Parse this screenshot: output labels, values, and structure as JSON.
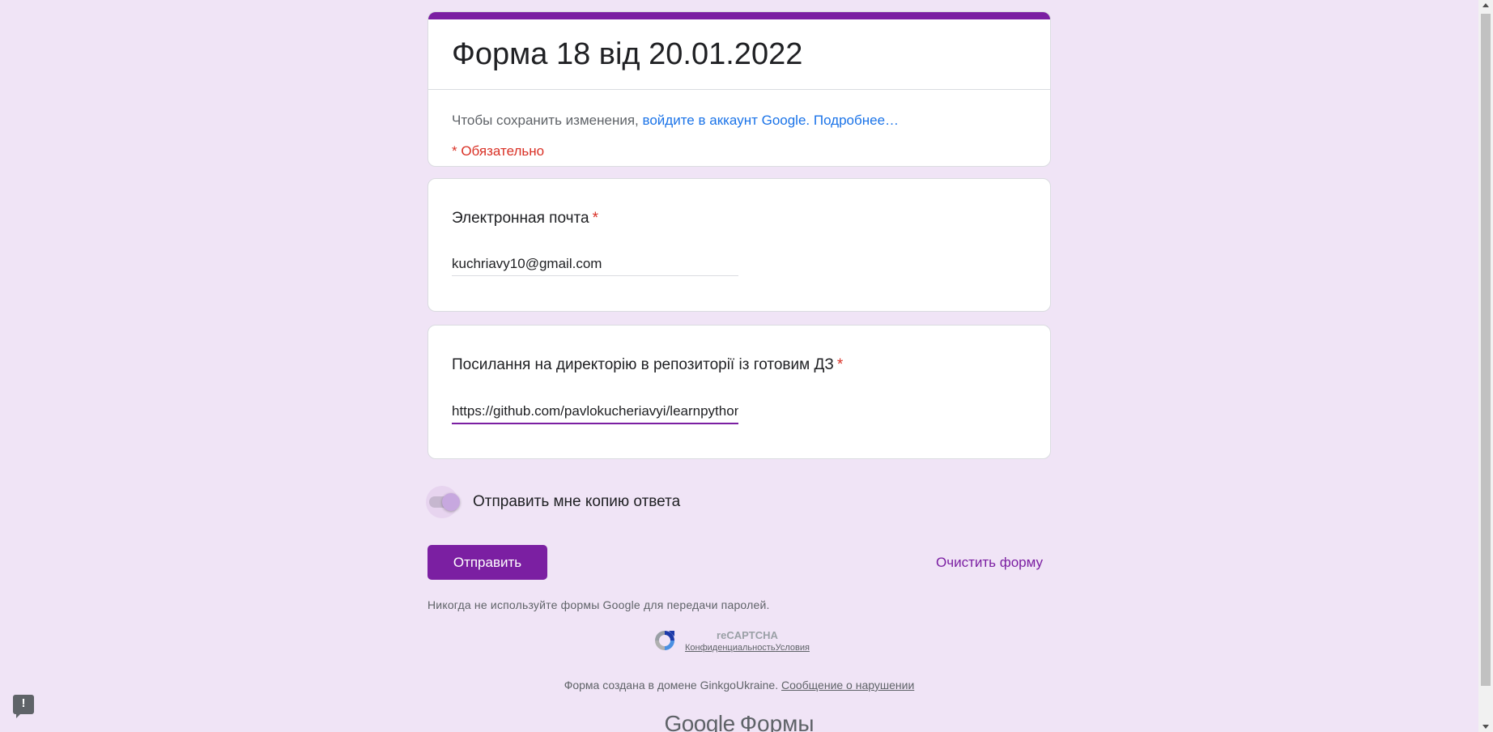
{
  "form": {
    "title": "Форма 18 від 20.01.2022",
    "signin_prefix": "Чтобы сохранить изменения,",
    "signin_link": "войдите в аккаунт Google.",
    "more_link": "Подробнее…",
    "required_note": "* Обязательно",
    "accent_color": "#7b1fa2"
  },
  "questions": [
    {
      "label": "Электронная почта",
      "required_mark": "*",
      "value": "kuchriavy10@gmail.com"
    },
    {
      "label": "Посилання на директорію в репозиторії із готовим ДЗ",
      "required_mark": "*",
      "value": "https://github.com/pavlokucheriavyi/learnpython"
    }
  ],
  "copy_toggle": {
    "label": "Отправить мне копию ответа",
    "state": "on"
  },
  "actions": {
    "submit_label": "Отправить",
    "clear_label": "Очистить форму"
  },
  "footer": {
    "password_warning": "Никогда не используйте формы Google для передачи паролей.",
    "recaptcha_name": "reCAPTCHA",
    "privacy_link": "Конфиденциальность",
    "terms_link": "Условия",
    "domain_text": "Форма создана в домене GinkgoUkraine.",
    "report_link": "Сообщение о нарушении",
    "brand_google": "Google",
    "brand_forms": "Формы"
  },
  "report_button": {
    "glyph": "!"
  },
  "icons": {
    "report": "report-problem-icon",
    "recaptcha": "recaptcha-logo-icon"
  }
}
